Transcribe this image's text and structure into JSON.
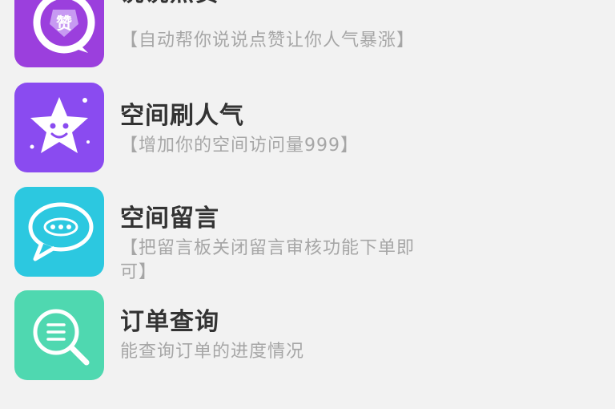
{
  "colors": {
    "background": "#f2f2f2",
    "title_text": "#333333",
    "desc_text": "#a6a6a6",
    "like_icon": "#9b3fdd",
    "visitors_icon": "#8a4bf0",
    "message_icon": "#2cc8e0",
    "order_icon": "#4fd8b0"
  },
  "services": [
    {
      "icon": "like-badge-icon",
      "title": "说说点赞",
      "desc": "【自动帮你说说点赞让你人气暴涨】"
    },
    {
      "icon": "star-face-icon",
      "title": "空间刷人气",
      "desc": "【增加你的空间访问量999】"
    },
    {
      "icon": "chat-bubble-icon",
      "title": "空间留言",
      "desc": "【把留言板关闭留言审核功能下单即可】"
    },
    {
      "icon": "search-list-icon",
      "title": "订单查询",
      "desc": "能查询订单的进度情况"
    }
  ]
}
